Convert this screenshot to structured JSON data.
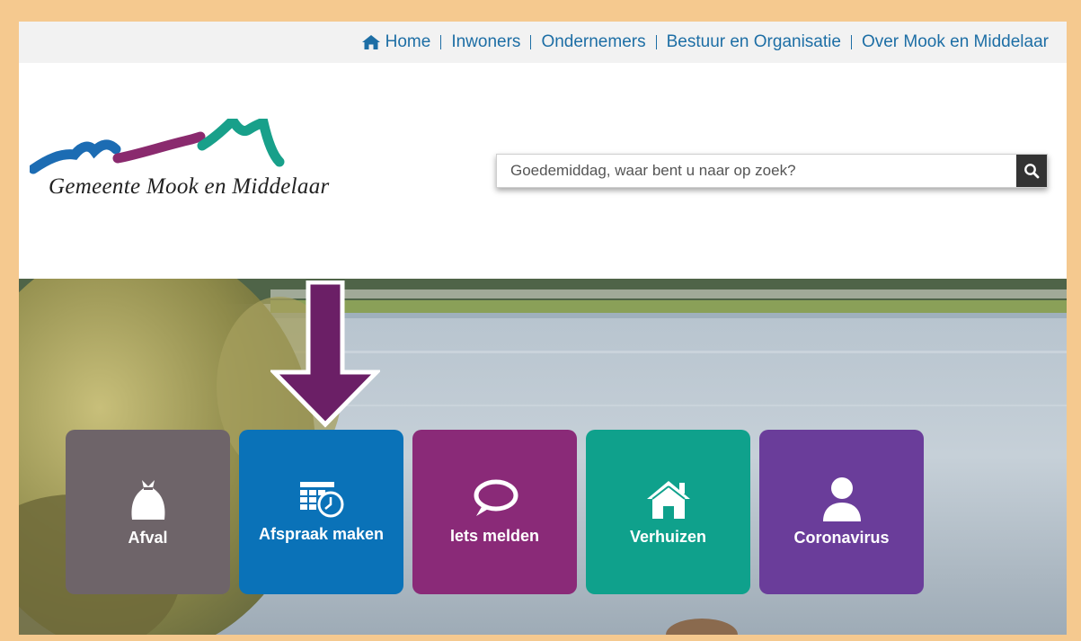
{
  "topnav": {
    "items": [
      {
        "label": "Home",
        "icon": "home-icon"
      },
      {
        "label": "Inwoners"
      },
      {
        "label": "Ondernemers"
      },
      {
        "label": "Bestuur en Organisatie"
      },
      {
        "label": "Over Mook en Middelaar"
      }
    ]
  },
  "logo": {
    "text": "Gemeente Mook en Middelaar"
  },
  "search": {
    "placeholder": "Goedemiddag, waar bent u naar op zoek?",
    "icon": "search-icon"
  },
  "tiles": [
    {
      "label": "Afval",
      "icon": "garbage-bag-icon",
      "color": "#6e6469"
    },
    {
      "label": "Afspraak maken",
      "icon": "calendar-clock-icon",
      "color": "#0a72b8"
    },
    {
      "label": "Iets melden",
      "icon": "speech-bubble-icon",
      "color": "#8a2a78"
    },
    {
      "label": "Verhuizen",
      "icon": "house-icon",
      "color": "#0fa18c"
    },
    {
      "label": "Coronavirus",
      "icon": "person-icon",
      "color": "#6a3d9a"
    }
  ],
  "colors": {
    "accent": "#f5c98f",
    "nav_link": "#1d6ea5",
    "arrow": "#6b1f66"
  }
}
